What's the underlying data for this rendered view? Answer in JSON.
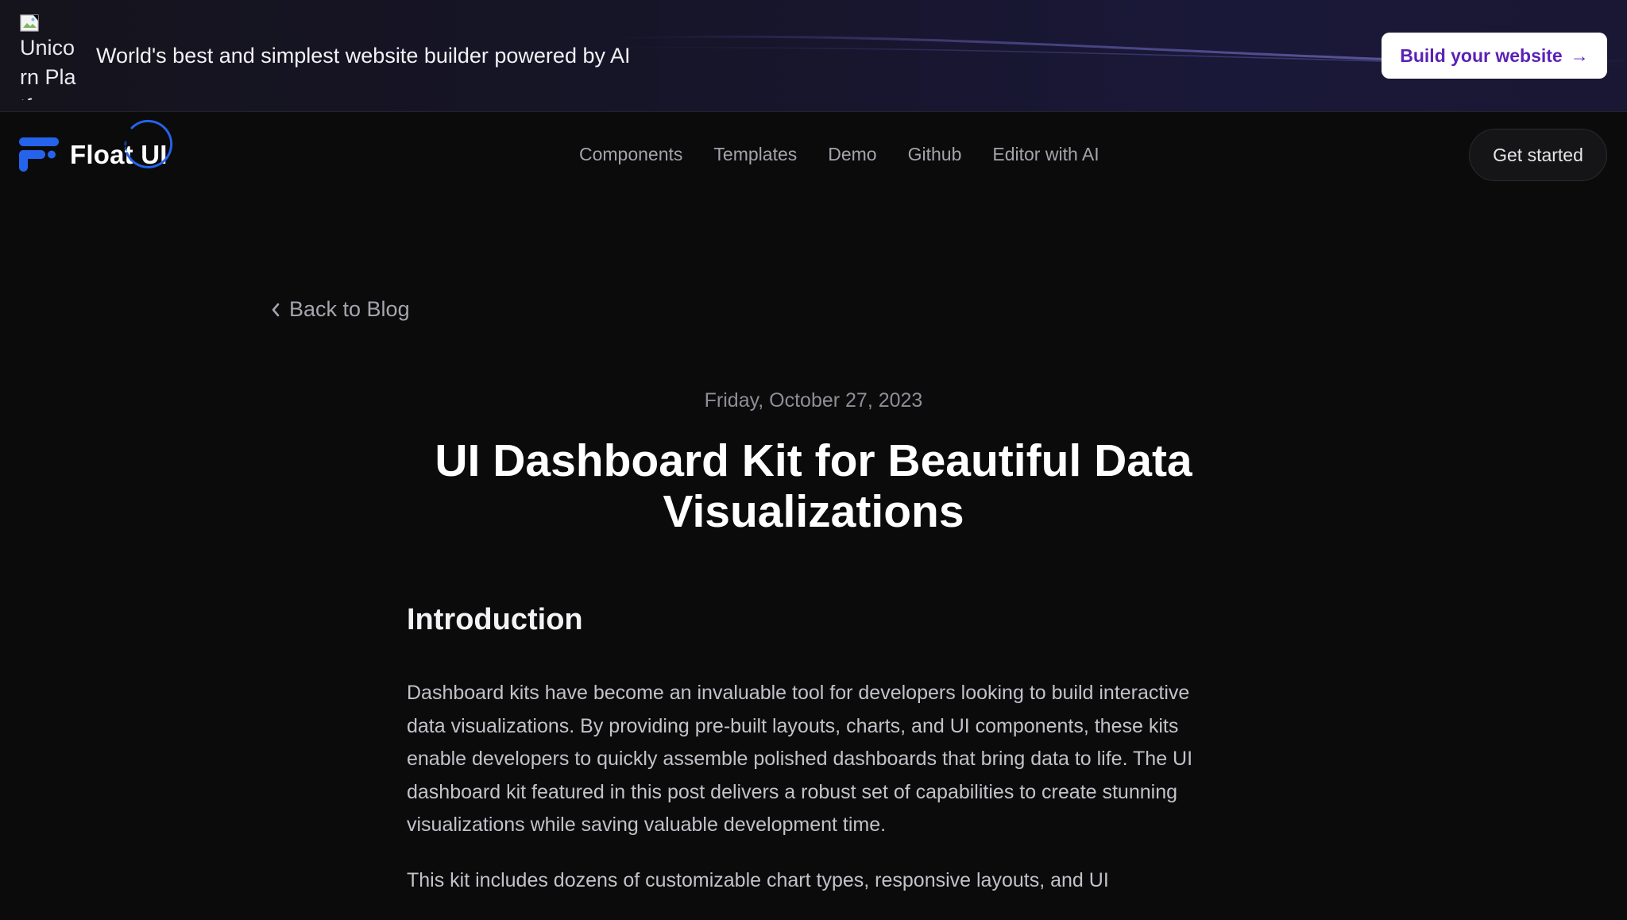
{
  "banner": {
    "logo_alt": "Unicorn Platform",
    "tagline": "World's best and simplest website builder powered by AI",
    "cta_label": "Build your website",
    "cta_arrow": "→"
  },
  "nav": {
    "brand": "Float UI",
    "links": [
      "Components",
      "Templates",
      "Demo",
      "Github",
      "Editor with AI"
    ],
    "get_started": "Get started"
  },
  "article": {
    "back_label": "Back to Blog",
    "date": "Friday, October 27, 2023",
    "title": "UI Dashboard Kit for Beautiful Data Visualizations",
    "section_heading": "Introduction",
    "paragraphs": [
      "Dashboard kits have become an invaluable tool for developers looking to build interactive data visualizations. By providing pre-built layouts, charts, and UI components, these kits enable developers to quickly assemble polished dashboards that bring data to life. The UI dashboard kit featured in this post delivers a robust set of capabilities to create stunning visualizations while saving valuable development time.",
      "This kit includes dozens of customizable chart types, responsive layouts, and UI"
    ]
  },
  "colors": {
    "page_bg": "#0b0b0c",
    "banner_bg": "#16152a",
    "cta_text": "#5b21b6",
    "brand_blue": "#2563eb",
    "nav_link": "#a3a3aa",
    "body_text": "#c2c2c9"
  },
  "icons": {
    "banner_logo": "broken-image-icon",
    "brand_logo": "float-ui-logo-icon",
    "back": "chevron-left-icon",
    "cta": "arrow-right-icon"
  }
}
